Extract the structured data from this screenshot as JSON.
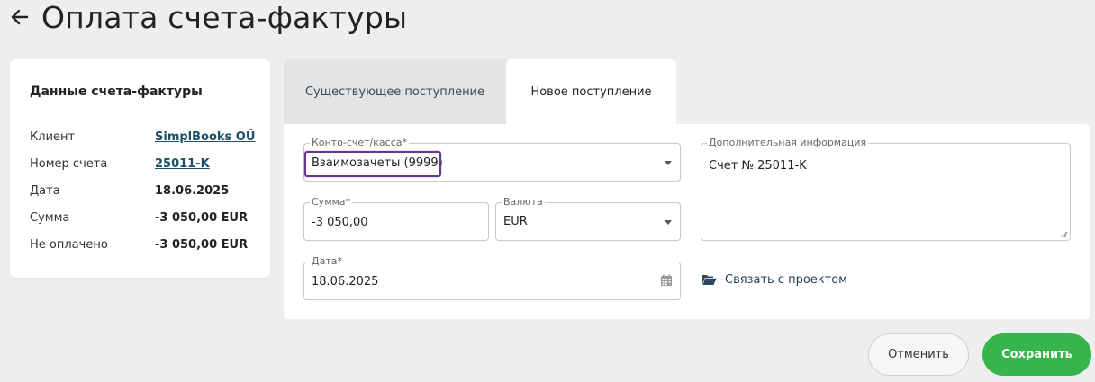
{
  "header": {
    "title": "Оплата счета-фактуры"
  },
  "invoice_card": {
    "title": "Данные счета-фактуры",
    "rows": [
      {
        "label": "Клиент",
        "value": "SimplBooks OÜ"
      },
      {
        "label": "Номер счета",
        "value": "25011-K"
      },
      {
        "label": "Дата",
        "value": "18.06.2025"
      },
      {
        "label": "Сумма",
        "value": "-3 050,00 EUR"
      },
      {
        "label": "Не оплачено",
        "value": "-3 050,00 EUR"
      }
    ]
  },
  "tabs": [
    {
      "label": "Существующее поступление",
      "active": false
    },
    {
      "label": "Новое поступление",
      "active": true
    }
  ],
  "form": {
    "account": {
      "label": "Конто-счет/касса*",
      "value": "Взаимозачеты (9999)"
    },
    "amount": {
      "label": "Сумма*",
      "value": "-3 050,00"
    },
    "currency": {
      "label": "Валюта",
      "value": "EUR"
    },
    "date": {
      "label": "Дата*",
      "value": "18.06.2025"
    },
    "additional_info": {
      "label": "Дополнительная информация",
      "value": "Счет № 25011-K"
    },
    "project_link": "Связать с проектом"
  },
  "buttons": {
    "cancel": "Отменить",
    "save": "Сохранить"
  },
  "colors": {
    "accent_green": "#38b44d",
    "highlight_purple": "#6a3591",
    "link_blue": "#1e4e6a"
  }
}
